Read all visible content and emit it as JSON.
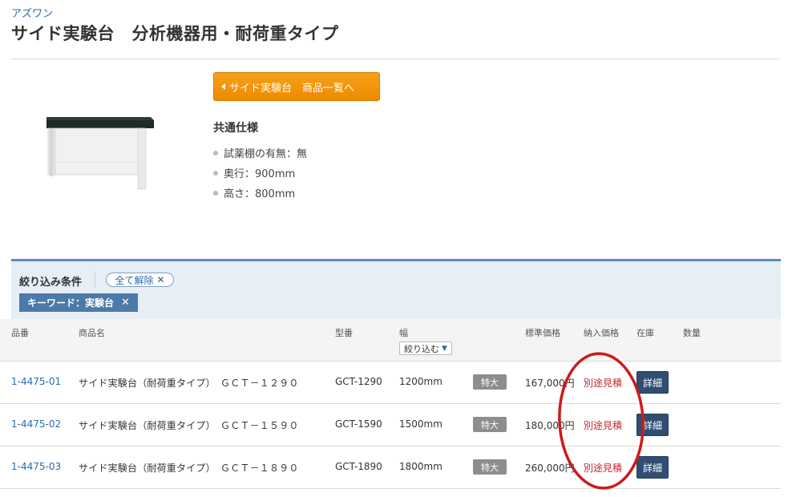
{
  "header": {
    "brand": "アズワン",
    "title": "サイド実験台　分析機器用・耐荷重タイプ"
  },
  "back_button": {
    "label": "サイド実験台　商品一覧へ"
  },
  "spec": {
    "heading": "共通仕様",
    "items": [
      "試薬棚の有無：無",
      "奥行：900mm",
      "高さ：800mm"
    ]
  },
  "filter": {
    "label": "絞り込み条件",
    "clear_all": "全て解除",
    "keyword_chip": "キーワード：実験台",
    "close_glyph": "✕"
  },
  "table": {
    "headers": {
      "code": "品番",
      "name": "商品名",
      "model": "型番",
      "width": "幅",
      "list_price": "標準価格",
      "delivery_price": "納入価格",
      "stock": "在庫",
      "quantity": "数量"
    },
    "narrow_label": "絞り込む",
    "rows": [
      {
        "code": "1-4475-01",
        "name": "サイド実験台（耐荷重タイプ）　ＧＣＴ－１２９０",
        "model": "GCT-1290",
        "width": "1200mm",
        "badge": "特大",
        "price": "167,000円",
        "quote": "別途見積",
        "detail": "詳細"
      },
      {
        "code": "1-4475-02",
        "name": "サイド実験台（耐荷重タイプ）　ＧＣＴ－１５９０",
        "model": "GCT-1590",
        "width": "1500mm",
        "badge": "特大",
        "price": "180,000円",
        "quote": "別途見積",
        "detail": "詳細"
      },
      {
        "code": "1-4475-03",
        "name": "サイド実験台（耐荷重タイプ）　ＧＣＴ－１８９０",
        "model": "GCT-1890",
        "width": "1800mm",
        "badge": "特大",
        "price": "260,000円",
        "quote": "別途見積",
        "detail": "詳細"
      }
    ]
  },
  "colors": {
    "accent_orange": "#ee8a00",
    "link_blue": "#2a6bb0",
    "quote_red": "#c0282d",
    "annotation_red": "#cc1b1b",
    "detail_button": "#2f4e72"
  }
}
